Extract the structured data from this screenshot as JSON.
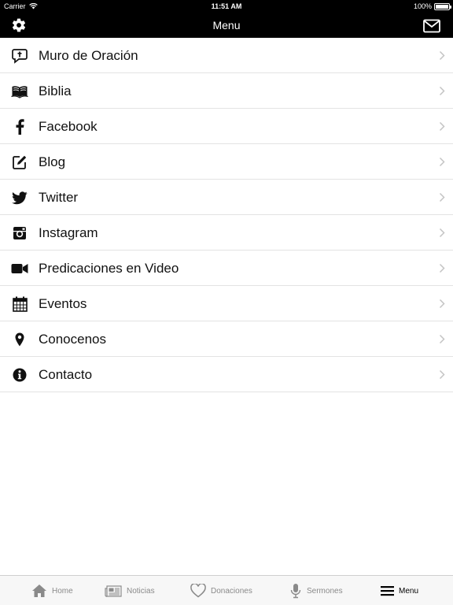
{
  "status_bar": {
    "carrier": "Carrier",
    "time": "11:51 AM",
    "battery": "100%"
  },
  "nav_bar": {
    "title": "Menu",
    "left_icon": "gear-icon",
    "right_icon": "mail-icon"
  },
  "menu": {
    "items": [
      {
        "label": "Muro de Oración",
        "icon": "prayer-bubble-icon"
      },
      {
        "label": "Biblia",
        "icon": "bible-book-icon"
      },
      {
        "label": "Facebook",
        "icon": "facebook-icon"
      },
      {
        "label": "Blog",
        "icon": "edit-icon"
      },
      {
        "label": "Twitter",
        "icon": "twitter-icon"
      },
      {
        "label": "Instagram",
        "icon": "instagram-icon"
      },
      {
        "label": "Predicaciones en Video",
        "icon": "video-camera-icon"
      },
      {
        "label": "Eventos",
        "icon": "calendar-icon"
      },
      {
        "label": "Conocenos",
        "icon": "map-pin-icon"
      },
      {
        "label": "Contacto",
        "icon": "info-icon"
      }
    ]
  },
  "tab_bar": {
    "tabs": [
      {
        "label": "Home",
        "icon": "home-icon",
        "active": false
      },
      {
        "label": "Noticias",
        "icon": "newspaper-icon",
        "active": false
      },
      {
        "label": "Donaciones",
        "icon": "heart-icon",
        "active": false
      },
      {
        "label": "Sermones",
        "icon": "microphone-icon",
        "active": false
      },
      {
        "label": "Menu",
        "icon": "hamburger-menu-icon",
        "active": true
      }
    ]
  },
  "colors": {
    "bar_background": "#000000",
    "tab_active": "#000000",
    "tab_inactive": "#8a8a8a",
    "divider": "#e3e3e3"
  }
}
